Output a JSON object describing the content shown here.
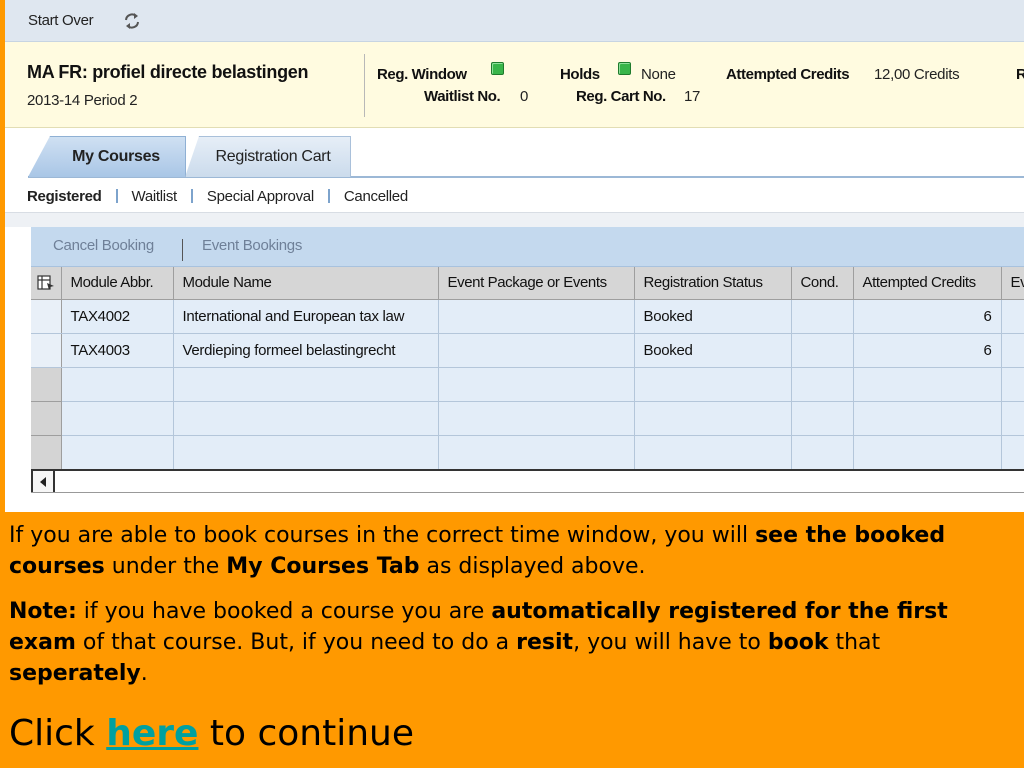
{
  "toolbar": {
    "start_over_label": "Start Over",
    "refresh_icon": "refresh-icon"
  },
  "program": {
    "title": "MA FR: profiel directe belastingen",
    "period": "2013-14 Period 2"
  },
  "status": {
    "reg_window_label": "Reg. Window",
    "reg_window_color": "#39b54a",
    "holds_label": "Holds",
    "holds_color": "#39b54a",
    "holds_value": "None",
    "attempted_credits_label": "Attempted Credits",
    "attempted_credits_value": "12,00 Credits",
    "truncated_label": "R",
    "waitlist_label": "Waitlist No.",
    "waitlist_value": "0",
    "reg_cart_label": "Reg. Cart No.",
    "reg_cart_value": "17"
  },
  "tabs": [
    {
      "label": "My Courses",
      "active": true
    },
    {
      "label": "Registration Cart",
      "active": false
    }
  ],
  "subtabs": [
    {
      "label": "Registered",
      "active": true
    },
    {
      "label": "Waitlist",
      "active": false
    },
    {
      "label": "Special Approval",
      "active": false
    },
    {
      "label": "Cancelled",
      "active": false
    }
  ],
  "table_toolbar": {
    "cancel_booking_label": "Cancel Booking",
    "event_bookings_label": "Event Bookings"
  },
  "table": {
    "settings_icon": "table-settings-icon",
    "columns": [
      "Module Abbr.",
      "Module Name",
      "Event Package or Events",
      "Registration Status",
      "Cond.",
      "Attempted Credits",
      "Ev"
    ],
    "rows": [
      {
        "abbr": "TAX4002",
        "name": "International and European tax law",
        "event": "",
        "status": "Booked",
        "cond": "",
        "credits": "6",
        "ev": ""
      },
      {
        "abbr": "TAX4003",
        "name": "Verdieping formeel belastingrecht",
        "event": "",
        "status": "Booked",
        "cond": "",
        "credits": "6",
        "ev": ""
      }
    ]
  },
  "caption": {
    "p1_a": "If you are able to book courses in the correct time window, you will ",
    "p1_b": "see the booked courses",
    "p1_c": " under the ",
    "p1_d": "My Courses Tab",
    "p1_e": " as displayed above.",
    "p2_a": "Note:",
    "p2_b": " if you have booked a course you are ",
    "p2_c": "automatically registered for the first exam",
    "p2_d": " of that course. But, if you need to do a ",
    "p2_e": "resit",
    "p2_f": ", you will have to ",
    "p2_g": "book",
    "p2_h": " that ",
    "p2_i": "seperately",
    "p2_j": ".",
    "continue_a": "Click ",
    "continue_link": "here",
    "continue_b": " to continue"
  }
}
